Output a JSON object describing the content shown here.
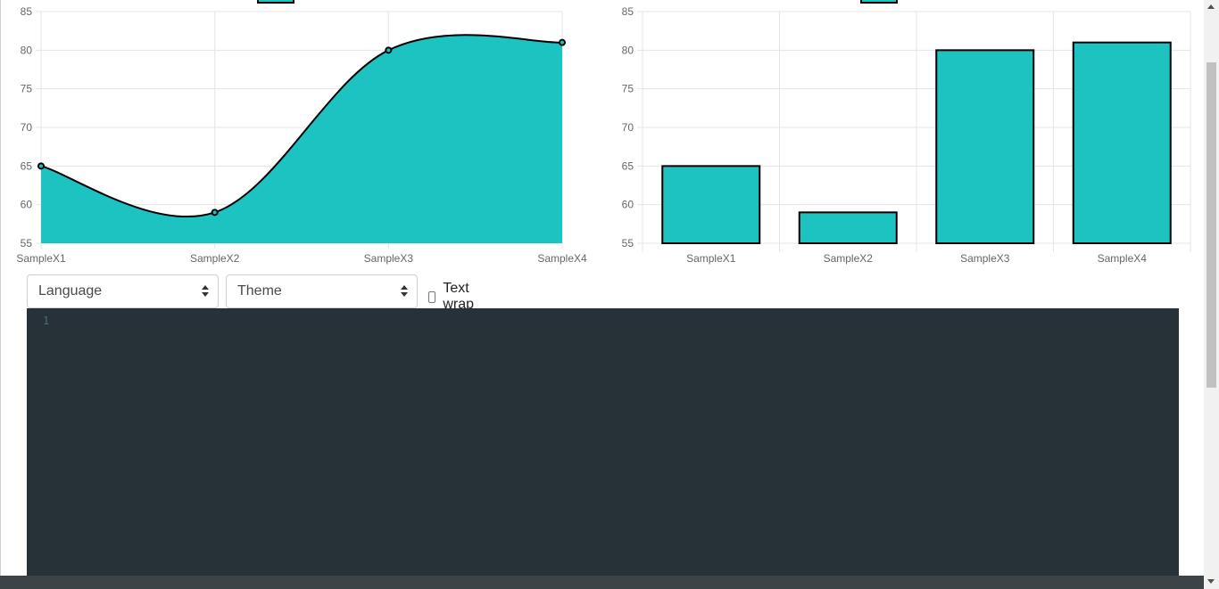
{
  "controls": {
    "language_label": "Language",
    "theme_label": "Theme",
    "text_wrap_label": "Text wrap",
    "text_wrap_checked": false
  },
  "editor": {
    "line_numbers": [
      "1"
    ],
    "background_color": "#263238"
  },
  "icons": {
    "select_arrows": "updown-chevron-icon",
    "scroll_up": "triangle-up-icon",
    "scroll_down": "triangle-down-icon"
  },
  "colors": {
    "series_fill": "#1cc3c1",
    "series_stroke": "#000000",
    "grid": "#e5e5e5"
  },
  "chart_data": [
    {
      "type": "area",
      "categories": [
        "SampleX1",
        "SampleX2",
        "SampleX3",
        "SampleX4"
      ],
      "values": [
        65,
        59,
        80,
        81
      ],
      "ylim": [
        55,
        85
      ],
      "yticks": [
        85,
        80,
        75,
        70,
        65,
        60,
        55
      ],
      "grid": true,
      "legend_position": "top",
      "smooth": true
    },
    {
      "type": "bar",
      "categories": [
        "SampleX1",
        "SampleX2",
        "SampleX3",
        "SampleX4"
      ],
      "values": [
        65,
        59,
        80,
        81
      ],
      "ylim": [
        55,
        85
      ],
      "yticks": [
        85,
        80,
        75,
        70,
        65,
        60,
        55
      ],
      "grid": true,
      "legend_position": "top"
    }
  ]
}
